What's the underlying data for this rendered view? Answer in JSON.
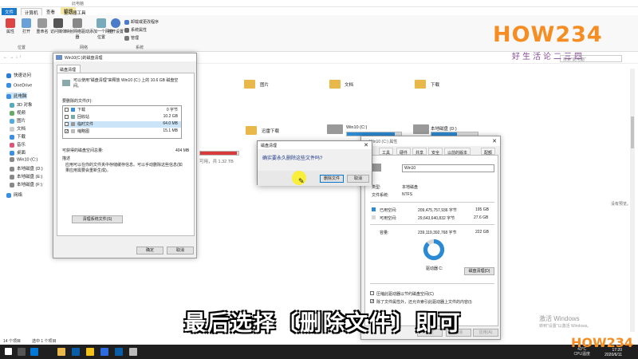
{
  "explorer": {
    "title": "此电脑",
    "tabs": [
      "文件",
      "计算机",
      "查看",
      "驱动器工具"
    ],
    "manage_tab": "管理",
    "ribbon": {
      "properties": "属性",
      "open": "打开",
      "rename": "重命名",
      "access_media": "访问媒体",
      "map_drive": "映射网络驱动器",
      "add_location": "添加一个网络位置",
      "open_settings": "打开设置",
      "uninstall": "卸载或更改程序",
      "system_props": "系统属性",
      "manage": "管理",
      "group_location": "位置",
      "group_network": "网络",
      "group_system": "系统"
    },
    "search_placeholder": "搜索\"此电脑\"",
    "nav": [
      "快速访问",
      "OneDrive",
      "此电脑",
      "3D 对象",
      "视频",
      "图片",
      "文档",
      "下载",
      "音乐",
      "桌面",
      "Win10 (C:)",
      "本地磁盘 (D:)",
      "本地磁盘 (E:)",
      "本地磁盘 (F:)",
      "网络"
    ],
    "folders": [
      "图片",
      "文档",
      "下载",
      "迅雷下载"
    ],
    "drives": {
      "c_label": "Win10 (C:)",
      "d_label": "本地磁盘 (D:)",
      "e_free": "可用，共 1.32 TB",
      "c_used_fraction": 0.88,
      "e_used_fraction": 0.95
    },
    "no_preview": "没有预览。",
    "status_items": "14 个项目",
    "status_selected": "选中 1 个项目"
  },
  "logo": {
    "main": "HOW234",
    "sub": "好生活论二三四"
  },
  "cleanup": {
    "title": "Win10(C:)的磁盘清理",
    "tab": "磁盘清理",
    "intro": "可以使用\"磁盘清理\"来释放 Win10 (C:) 上的 10.6 GB 磁盘空间。",
    "files_label": "要删除的文件(F):",
    "files": [
      {
        "name": "下载",
        "size": "0 字节",
        "checked": false
      },
      {
        "name": "回收站",
        "size": "10.2 GB",
        "checked": false
      },
      {
        "name": "临时文件",
        "size": "64.0 MB",
        "checked": false
      },
      {
        "name": "缩略图",
        "size": "15.1 MB",
        "checked": true
      }
    ],
    "gain_label": "可获得的磁盘空间总量:",
    "gain_value": "404 MB",
    "desc_label": "描述",
    "desc_text": "应用可以在你的文件夹中存储缓存信息。可以手动删除这些信息(如果应用需要会重新生成)。",
    "cleanup_system": "清理系统文件(S)",
    "ok": "确定",
    "cancel": "取消"
  },
  "confirm": {
    "title": "磁盘清理",
    "message": "确实要永久删除这些文件吗?",
    "delete": "删除文件",
    "cancel": "取消"
  },
  "props": {
    "title": "Win10 (C:) 属性",
    "tabs": [
      "工具",
      "硬件",
      "共享",
      "安全",
      "以前的版本",
      "配额"
    ],
    "name": "Win10",
    "type_label": "类型:",
    "type_value": "本地磁盘",
    "fs_label": "文件系统:",
    "fs_value": "NTFS",
    "used_label": "已用空间:",
    "used_bytes": "209,475,757,936 字节",
    "used_gb": "195 GB",
    "free_label": "可用空间:",
    "free_bytes": "29,643,640,832 字节",
    "free_gb": "27.6 GB",
    "cap_label": "容量:",
    "cap_bytes": "239,119,392,768 字节",
    "cap_gb": "222 GB",
    "drive_label": "驱动器 C:",
    "cleanup_btn": "磁盘清理(D)",
    "compress": "压缩此驱动器以节约磁盘空间(C)",
    "index": "除了文件属性外，还允许索引此驱动器上文件的内容(I)",
    "ok": "确定",
    "cancel": "取消",
    "apply": "应用(A)",
    "used_fraction": 0.876,
    "used_color": "#2a8ad4",
    "free_color": "#d8d8d8"
  },
  "caption": "最后选择〔删除文件〕即可",
  "activation": {
    "title": "激活 Windows",
    "sub": "转到\"设置\"以激活 Windows。"
  },
  "taskbar": {
    "temp": "43°C",
    "cpu": "CPU温度",
    "time": "17:20",
    "date": "2020/6/11"
  }
}
